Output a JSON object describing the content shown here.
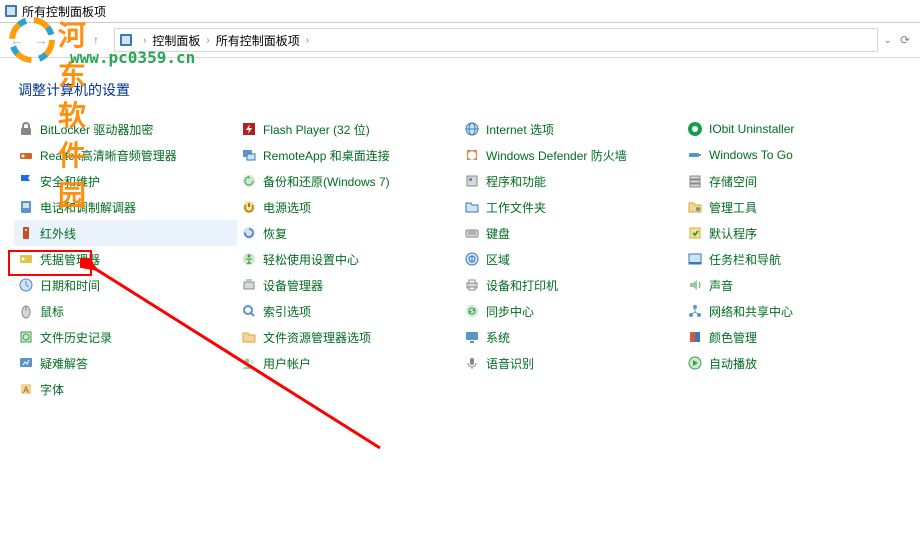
{
  "window": {
    "title": "所有控制面板项"
  },
  "breadcrumb": {
    "item1": "控制面板",
    "item2": "所有控制面板项"
  },
  "header": {
    "text": "调整计算机的设置"
  },
  "watermark": {
    "brand": "河东软件园",
    "url": "www.pc0359.cn"
  },
  "columns": [
    [
      {
        "icon": "bitlocker",
        "label": "BitLocker 驱动器加密"
      },
      {
        "icon": "realtek",
        "label": "Realtek高清晰音频管理器"
      },
      {
        "icon": "flag",
        "label": "安全和维护"
      },
      {
        "icon": "phone",
        "label": "电话和调制解调器"
      },
      {
        "icon": "infrared",
        "label": "红外线",
        "selected": true
      },
      {
        "icon": "credential",
        "label": "凭据管理器"
      },
      {
        "icon": "clock",
        "label": "日期和时间"
      },
      {
        "icon": "mouse",
        "label": "鼠标"
      },
      {
        "icon": "filehistory",
        "label": "文件历史记录"
      },
      {
        "icon": "troubleshoot",
        "label": "疑难解答"
      },
      {
        "icon": "fonts",
        "label": "字体"
      }
    ],
    [
      {
        "icon": "flash",
        "label": "Flash Player (32 位)"
      },
      {
        "icon": "remoteapp",
        "label": "RemoteApp 和桌面连接"
      },
      {
        "icon": "backup",
        "label": "备份和还原(Windows 7)"
      },
      {
        "icon": "power",
        "label": "电源选项"
      },
      {
        "icon": "recovery",
        "label": "恢复"
      },
      {
        "icon": "ease",
        "label": "轻松使用设置中心"
      },
      {
        "icon": "devmgr",
        "label": "设备管理器"
      },
      {
        "icon": "indexing",
        "label": "索引选项"
      },
      {
        "icon": "explorer",
        "label": "文件资源管理器选项"
      },
      {
        "icon": "users",
        "label": "用户帐户"
      }
    ],
    [
      {
        "icon": "internet",
        "label": "Internet 选项"
      },
      {
        "icon": "defender",
        "label": "Windows Defender 防火墙"
      },
      {
        "icon": "programs",
        "label": "程序和功能"
      },
      {
        "icon": "workfolders",
        "label": "工作文件夹"
      },
      {
        "icon": "keyboard",
        "label": "键盘"
      },
      {
        "icon": "region",
        "label": "区域"
      },
      {
        "icon": "printers",
        "label": "设备和打印机"
      },
      {
        "icon": "sync",
        "label": "同步中心"
      },
      {
        "icon": "system",
        "label": "系统"
      },
      {
        "icon": "speech",
        "label": "语音识别"
      }
    ],
    [
      {
        "icon": "iobit",
        "label": "IObit Uninstaller"
      },
      {
        "icon": "togo",
        "label": "Windows To Go"
      },
      {
        "icon": "storage",
        "label": "存储空间"
      },
      {
        "icon": "admintools",
        "label": "管理工具"
      },
      {
        "icon": "default",
        "label": "默认程序"
      },
      {
        "icon": "taskbar",
        "label": "任务栏和导航"
      },
      {
        "icon": "sound",
        "label": "声音"
      },
      {
        "icon": "network",
        "label": "网络和共享中心"
      },
      {
        "icon": "color",
        "label": "颜色管理"
      },
      {
        "icon": "autoplay",
        "label": "自动播放"
      }
    ]
  ]
}
